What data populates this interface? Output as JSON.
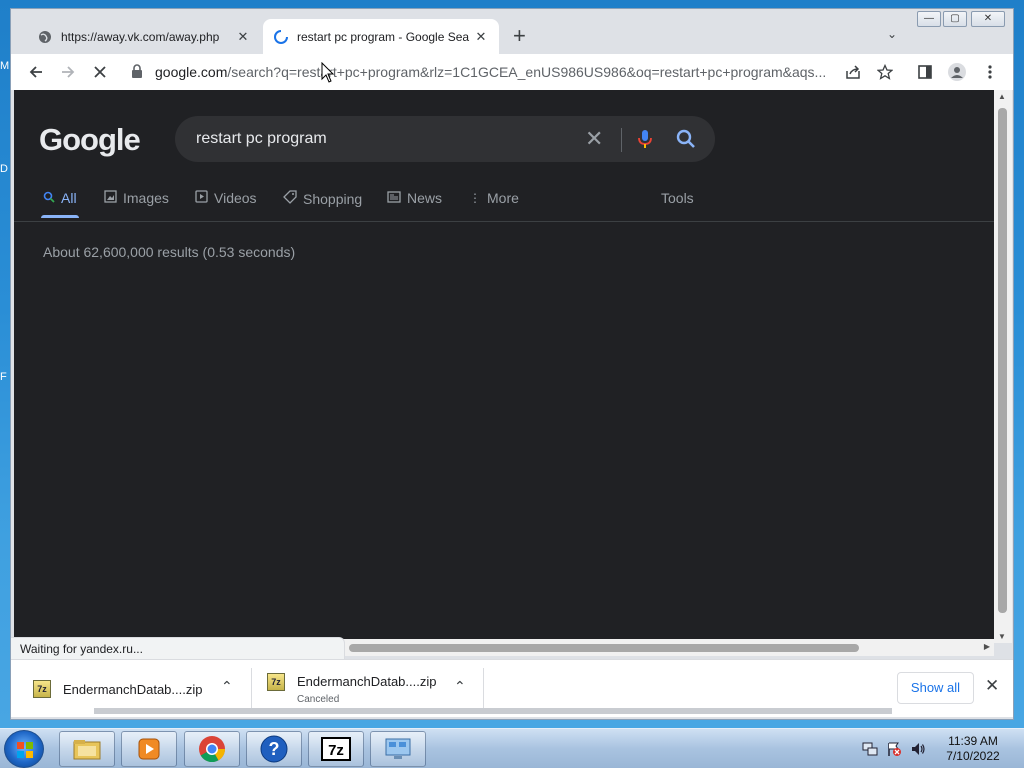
{
  "browser": {
    "tabs": [
      {
        "title": "https://away.vk.com/away.php",
        "active": false
      },
      {
        "title": "restart pc program - Google Sea",
        "active": true
      }
    ],
    "new_tab_label": "+",
    "address": {
      "host": "google.com",
      "rest": "/search?q=restart+pc+program&rlz=1C1GCEA_enUS986US986&oq=restart+pc+program&aqs..."
    },
    "window_controls": {
      "minimize": "—",
      "maximize": "▢",
      "close": "✕"
    }
  },
  "page": {
    "logo": "Google",
    "search_query": "restart pc program",
    "nav_tabs": [
      {
        "label": "All",
        "icon": "search-icon",
        "active": true
      },
      {
        "label": "Images",
        "icon": "image-icon",
        "active": false
      },
      {
        "label": "Videos",
        "icon": "play-icon",
        "active": false
      },
      {
        "label": "Shopping",
        "icon": "tag-icon",
        "active": false
      },
      {
        "label": "News",
        "icon": "news-icon",
        "active": false
      },
      {
        "label": "More",
        "icon": "more-vertical-icon",
        "active": false
      }
    ],
    "tools_label": "Tools",
    "result_stats": "About 62,600,000 results (0.53 seconds)"
  },
  "status_text": "Waiting for yandex.ru...",
  "downloads": {
    "items": [
      {
        "name": "EndermanchDatab....zip",
        "status": ""
      },
      {
        "name": "EndermanchDatab....zip",
        "status": "Canceled"
      }
    ],
    "show_all_label": "Show all"
  },
  "taskbar": {
    "clock_time": "11:39 AM",
    "clock_date": "7/10/2022",
    "apps": [
      "explorer-icon",
      "media-player-icon",
      "chrome-icon",
      "help-icon",
      "7zip-icon",
      "control-panel-icon"
    ]
  },
  "colors": {
    "page_bg": "#202124",
    "accent": "#8ab4f8",
    "search_box": "#303134"
  }
}
